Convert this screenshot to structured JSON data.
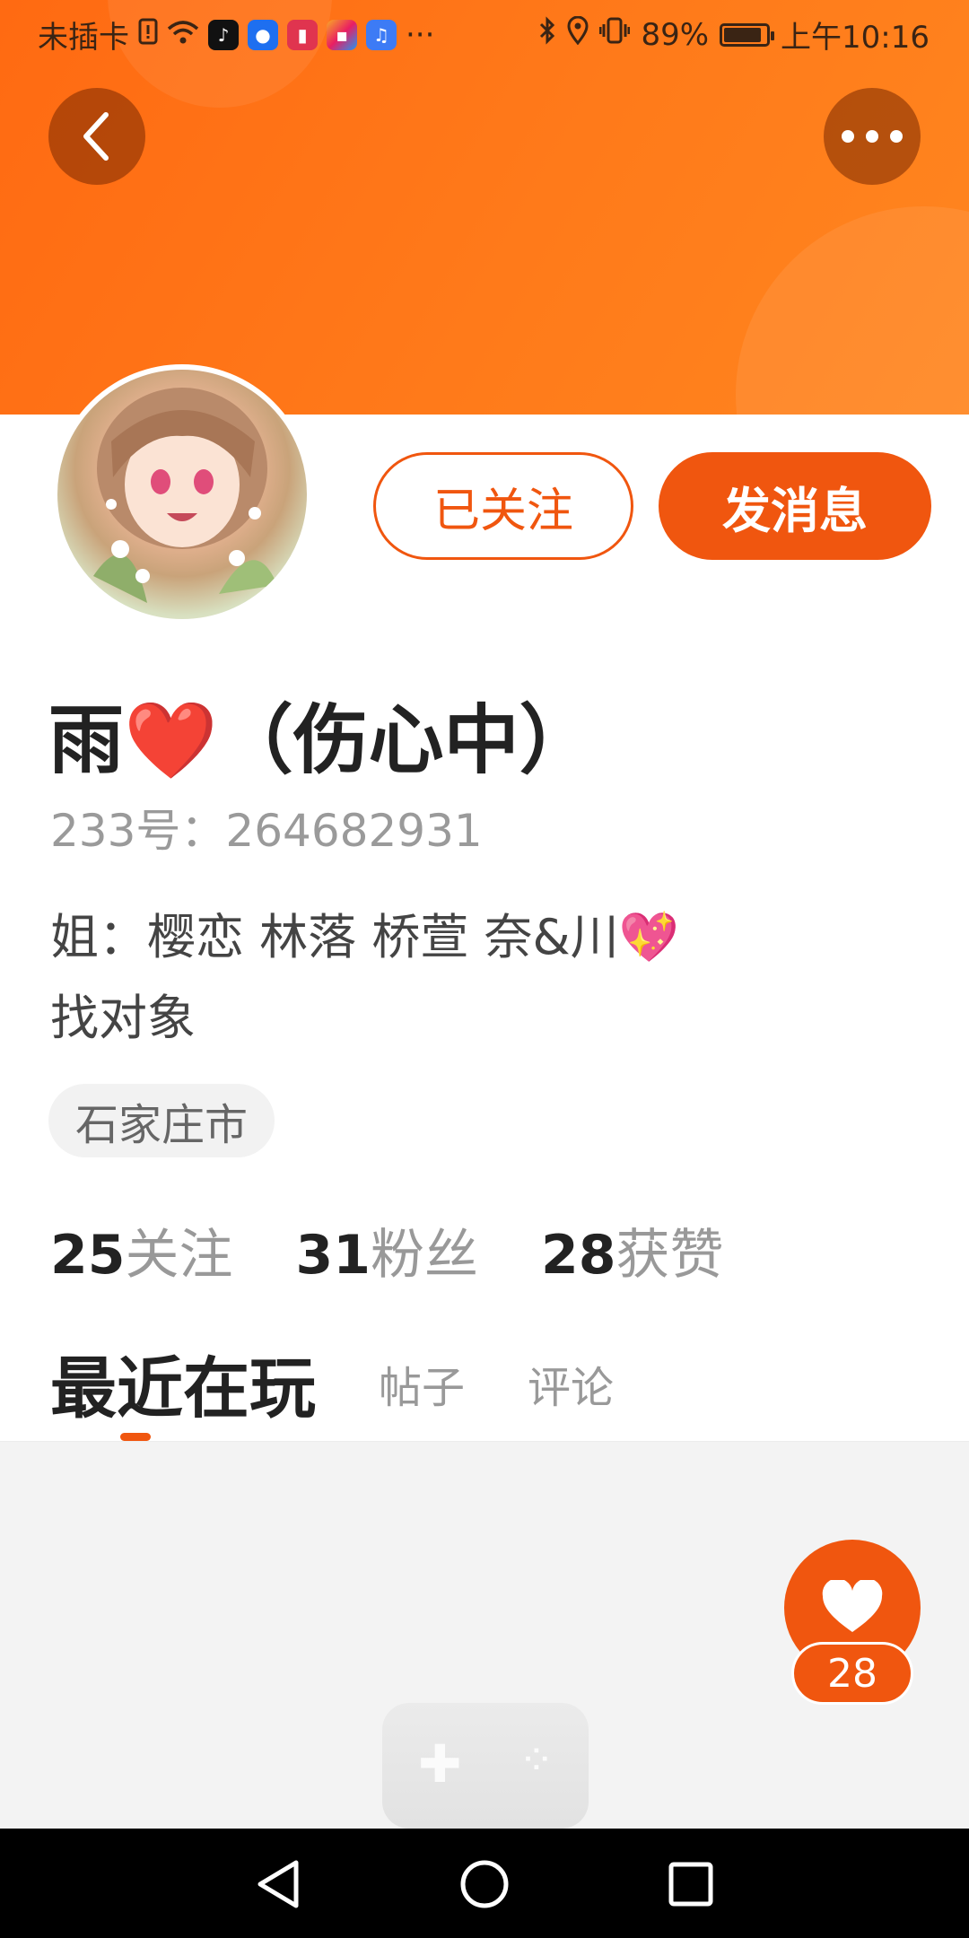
{
  "status_bar": {
    "carrier": "未插卡",
    "battery_percent": "89%",
    "battery_level": 0.89,
    "time": "上午10:16",
    "more_indicator": "···",
    "icons": [
      "sim-alert-icon",
      "wifi-icon",
      "tiktok-icon",
      "app-icon",
      "reader-icon",
      "app-icon",
      "music-icon",
      "bluetooth-icon",
      "location-icon",
      "vibrate-icon"
    ]
  },
  "colors": {
    "accent": "#f0560f",
    "header": "#ff7a1a"
  },
  "profile": {
    "nickname": "雨❤️（伤心中）",
    "uid_label": "233号：264682931",
    "bio_line1": "姐：樱恋 林落 桥萱 奈&川💖",
    "bio_line2": "找对象",
    "location": "石家庄市"
  },
  "actions": {
    "follow_label": "已关注",
    "message_label": "发消息"
  },
  "stats": {
    "following_count": "25",
    "following_label": "关注",
    "fans_count": "31",
    "fans_label": "粉丝",
    "likes_count": "28",
    "likes_label": "获赞"
  },
  "tabs": {
    "recent_label": "最近在玩",
    "posts_label": "帖子",
    "comments_label": "评论"
  },
  "like_fab": {
    "count": "28"
  }
}
